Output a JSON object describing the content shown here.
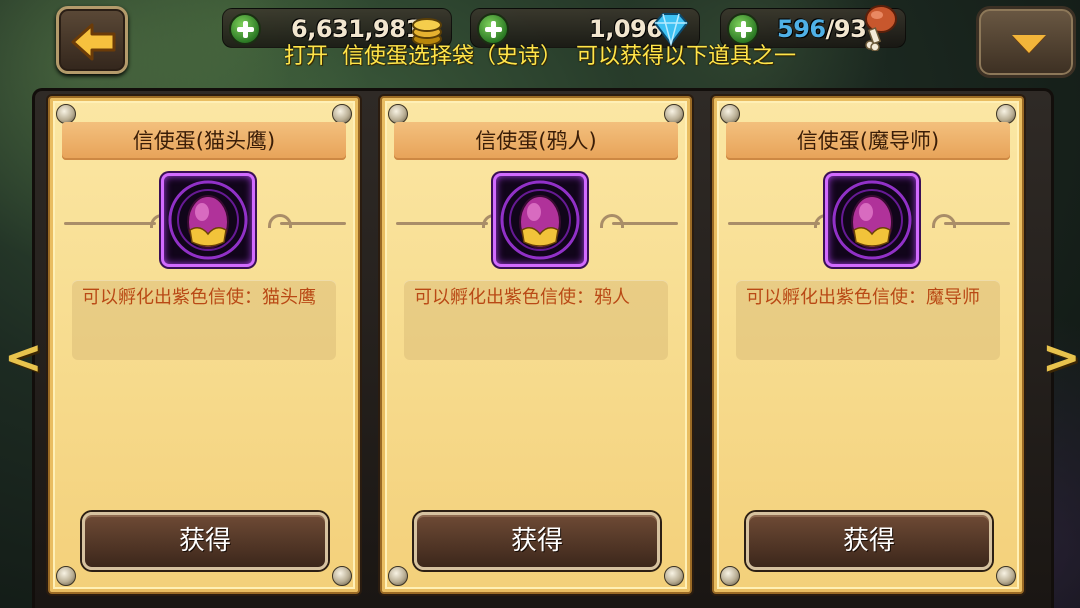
{
  "hud": {
    "gold": "6,631,981",
    "gems": "1,096",
    "stamina_current": "596",
    "stamina_sep": "/",
    "stamina_max": "93",
    "icons": [
      "back-arrow-icon",
      "plus-icon",
      "gold-coin-icon",
      "diamond-icon",
      "meat-icon",
      "dropdown-triangle-icon"
    ]
  },
  "dialog": {
    "title": "打开  信使蛋选择袋（史诗）  可以获得以下道具之一"
  },
  "cards": [
    {
      "title": "信使蛋(猫头鹰)",
      "description": "可以孵化出紫色信使：猫头鹰",
      "button": "获得"
    },
    {
      "title": "信使蛋(鸦人)",
      "description": "可以孵化出紫色信使：鸦人",
      "button": "获得"
    },
    {
      "title": "信使蛋(魔导师)",
      "description": "可以孵化出紫色信使：魔导师",
      "button": "获得"
    }
  ],
  "nav": {
    "prev": "<",
    "next": ">"
  },
  "colors": {
    "title_yellow": "#ffe54a",
    "card_bg": "#f7dc8f",
    "desc_text": "#b94915",
    "egg_frame": "#d26bff"
  }
}
